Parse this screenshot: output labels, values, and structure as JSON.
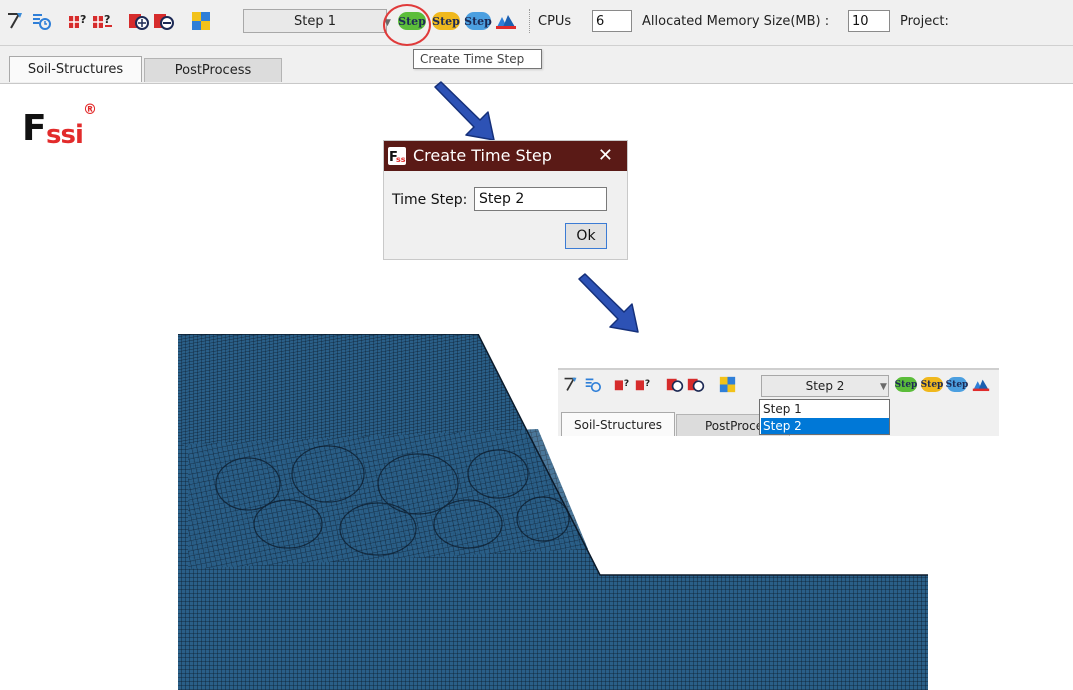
{
  "toolbar": {
    "step_combo_value": "Step 1",
    "step_button_label": "Step",
    "cpus_label": "CPUs",
    "cpus_value": "6",
    "memory_label": "Allocated Memory Size(MB) :",
    "memory_value": "10",
    "project_label": "Project:",
    "tooltip": "Create Time Step",
    "icons": [
      "draw-line-icon",
      "time-step-icon",
      "add-boundary-icon",
      "remove-boundary-icon",
      "add-load-icon",
      "remove-load-icon",
      "color-grid-icon",
      "create-step-icon",
      "edit-step-icon",
      "delete-step-icon",
      "run-analysis-icon"
    ]
  },
  "tabs": [
    {
      "label": "Soil-Structures"
    },
    {
      "label": "PostProcess"
    }
  ],
  "logo": {
    "text_f": "F",
    "text_ssi": "ssi",
    "registered": "®"
  },
  "dialog": {
    "title": "Create Time Step",
    "close": "✕",
    "time_step_label": "Time Step:",
    "time_step_value": "Step 2",
    "ok_label": "Ok"
  },
  "inset": {
    "step_combo_value": "Step 2",
    "step_button_label": "Step",
    "tabs": [
      {
        "label": "Soil-Structures"
      },
      {
        "label": "PostProces"
      }
    ],
    "dropdown_options": [
      "Step 1",
      "Step 2"
    ],
    "selected_option": "Step 2"
  },
  "colors": {
    "mesh_fill": "#2a5f88",
    "mesh_line": "#0b1a2a",
    "dialog_title_bg": "#5a1a16",
    "arrow": "#2d52b5",
    "highlight_circle": "#e03a3a",
    "selection": "#0078d7"
  }
}
